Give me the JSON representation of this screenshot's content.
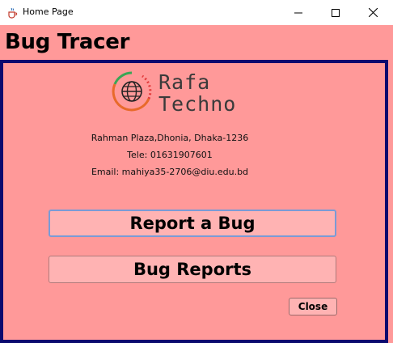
{
  "window": {
    "title": "Home Page",
    "icon": "java-cup-icon",
    "controls": [
      "minimize-icon",
      "maximize-icon",
      "close-icon"
    ]
  },
  "app": {
    "header": "Bug Tracer"
  },
  "logo": {
    "line1": "Rafa",
    "line2": "Techno",
    "icon": "globe-icon"
  },
  "contact": {
    "address": "Rahman Plaza,Dhonia, Dhaka-1236",
    "phone": "Tele: 01631907601",
    "email": "Email: mahiya35-2706@diu.edu.bd"
  },
  "buttons": {
    "report_bug": "Report a Bug",
    "bug_reports": "Bug Reports",
    "close": "Close"
  },
  "colors": {
    "background": "#ff9999",
    "panel_border": "#0a0a6e",
    "button_fill": "#ffb3b3",
    "focus_border": "#7a9bd6"
  }
}
